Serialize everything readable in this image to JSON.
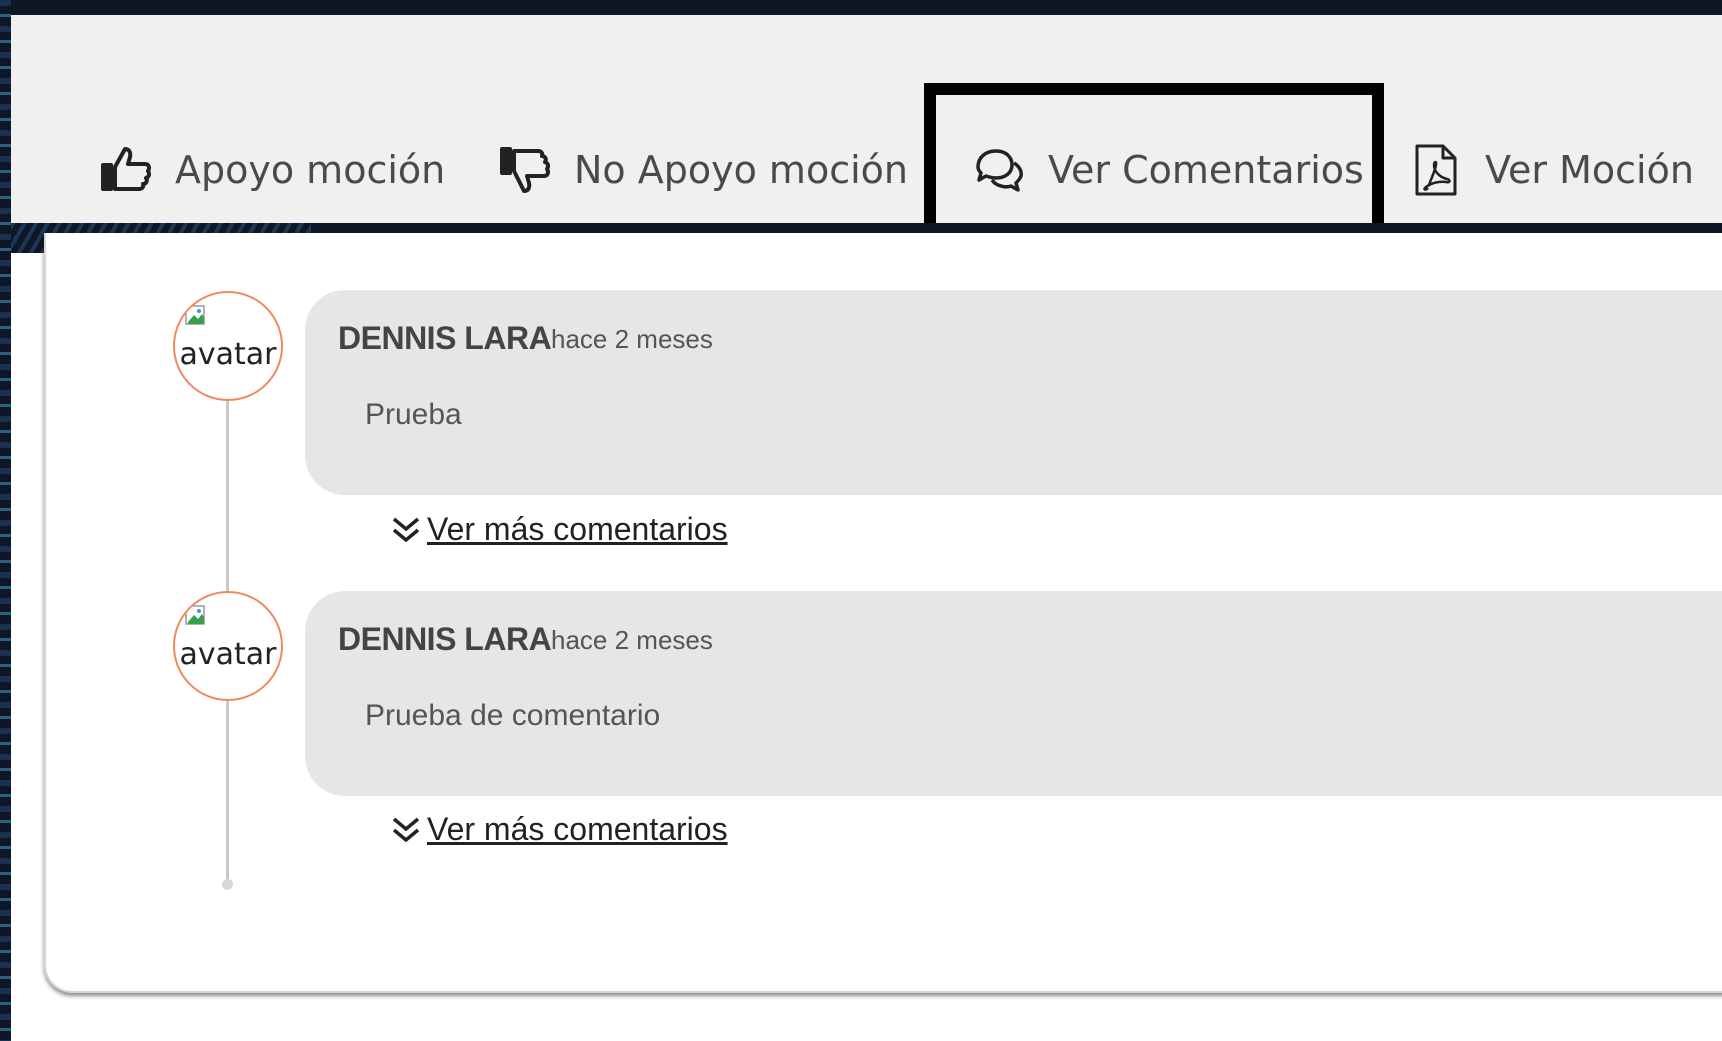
{
  "toolbar": {
    "support_label": "Apoyo moción",
    "no_support_label": "No Apoyo moción",
    "comments_label": "Ver Comentarios",
    "motion_label": "Ver Moción"
  },
  "comments": [
    {
      "avatar_alt": "avatar",
      "author": "DENNIS LARA",
      "time": "hace 2 meses",
      "text": "Prueba",
      "more_label": "Ver más comentarios"
    },
    {
      "avatar_alt": "avatar",
      "author": "DENNIS LARA",
      "time": "hace 2 meses",
      "text": "Prueba de comentario",
      "more_label": "Ver más comentarios"
    }
  ],
  "icons": {
    "support": "thumbs-up-icon",
    "no_support": "thumbs-down-icon",
    "comments": "chat-bubbles-icon",
    "motion": "pdf-file-icon",
    "more": "double-chevron-down-icon"
  },
  "colors": {
    "toolbar_bg": "#f0f0f0",
    "bubble_bg": "#e6e6e6",
    "avatar_border": "#f08a5d",
    "frame_bg": "#0f1626"
  }
}
